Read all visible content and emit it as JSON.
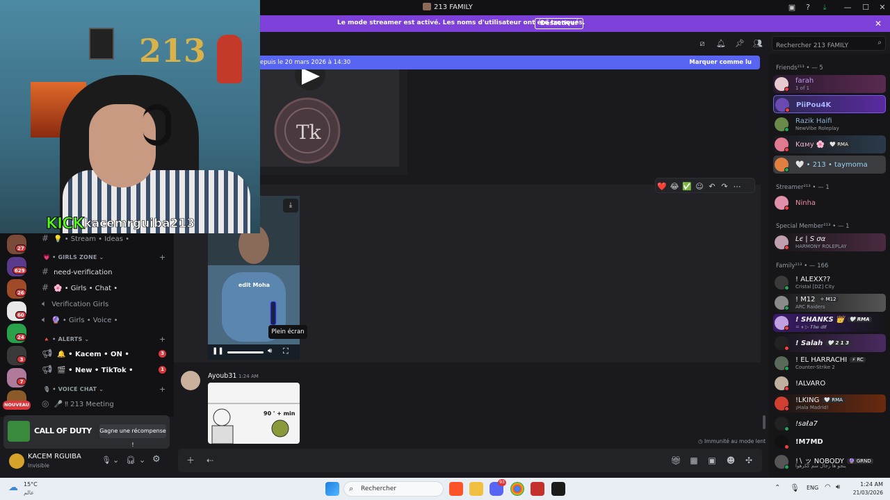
{
  "window": {
    "title": "213 FAMILY"
  },
  "banner": {
    "text": "Le mode streamer est activé. Les noms d'utilisateur ont été tronqués.",
    "button": "Désactiver"
  },
  "search": {
    "placeholder": "Rechercher 213 FAMILY"
  },
  "new_messages": {
    "since": "epuis le 20 mars 2026 à 14:30",
    "mark_read": "Marquer comme lu"
  },
  "stream_overlay": {
    "brand": "KICK",
    "username": "kacemrguiba213",
    "sign_text": "213"
  },
  "server_rail": {
    "badges": [
      "27",
      "629",
      "26",
      "60",
      "24",
      "3",
      "7"
    ],
    "new_label": "NOUVEAU"
  },
  "channels": [
    {
      "type": "channel",
      "label": "💡 • Stream • Ideas •"
    },
    {
      "type": "category",
      "label": "💗 • GIRLS ZONE"
    },
    {
      "type": "channel",
      "label": "need-verification"
    },
    {
      "type": "channel",
      "label": "🌸 • Girls • Chat •"
    },
    {
      "type": "voice",
      "label": "Verification Girls"
    },
    {
      "type": "voice",
      "label": "🔮 • Girls • Voice •"
    },
    {
      "type": "category",
      "label": "🔺 • ALERTS"
    },
    {
      "type": "announce",
      "label": "🔔 • Kacem • ON •",
      "badge": "3"
    },
    {
      "type": "announce",
      "label": "🎬 • New • TikTok •",
      "badge": "1"
    },
    {
      "type": "category",
      "label": "🎙 • VOICE CHAT"
    },
    {
      "type": "stage",
      "label": "🎤 ‼ 213 Meeting"
    }
  ],
  "promo": {
    "game": "CALL OF DUTY",
    "button": "Gagne une récompense !"
  },
  "user": {
    "name": "KACEM RGUIBA",
    "status": "Invisible"
  },
  "video": {
    "caption": "edit Moha",
    "tooltip": "Plein écran"
  },
  "reactions": [
    "❤️",
    "😂",
    "✅"
  ],
  "message": {
    "author": "Ayoub31",
    "time": "1:24 AM",
    "meme_text": "90 ' + min"
  },
  "slowmode": "Immunité au mode lent",
  "members": {
    "groups": [
      {
        "name": "Friends²¹³",
        "count": "— 5"
      },
      {
        "name": "Streamer²¹³",
        "count": "— 1"
      },
      {
        "name": "Special Member²¹³",
        "count": "— 1"
      },
      {
        "name": "Family²¹³",
        "count": "— 166"
      }
    ],
    "list": [
      {
        "name": "farah",
        "sub": "1 of 1",
        "color": "#c19cf0"
      },
      {
        "name": "PiiPou4K",
        "sub": "",
        "color": "#a8b4ff"
      },
      {
        "name": "Razik Haifi",
        "sub": "NewVibe Roleplay",
        "color": "#8fb2d9"
      },
      {
        "name": "Kαмy 🌸",
        "sub": "",
        "tag": "🤍 RMA",
        "color": "#f0b0d0"
      },
      {
        "name": "🤍 • 213 • taymoma",
        "sub": "",
        "color": "#9ad0f0"
      },
      {
        "name": "Ninha",
        "sub": "",
        "color": "#f38ba0"
      },
      {
        "name": "Lє | Ѕ σα",
        "sub": "HARMONY ROLEPLAY",
        "color": "#f2f3f5"
      },
      {
        "name": "! ALEXX??",
        "sub": "Cristal [DZ] City",
        "color": "#f2f3f5"
      },
      {
        "name": "! M12",
        "sub": "ARC Raiders",
        "tag": "✧ M12",
        "color": "#f2f3f5"
      },
      {
        "name": "! SHANKS 👑",
        "sub": "= ⏸ ▷ 𝑻𝒉𝒆 𝒅𝒊𝒇",
        "tag": "🤍 RMA",
        "color": "#f2f3f5"
      },
      {
        "name": "! Salah",
        "sub": "",
        "tag": "🤍 2 1 3",
        "color": "#f2f3f5"
      },
      {
        "name": "! EL HARRACHI",
        "sub": "Counter-Strike 2",
        "tag": "⚡ RC",
        "color": "#f2f3f5"
      },
      {
        "name": "!ALVARO",
        "sub": "",
        "color": "#f2f3f5"
      },
      {
        "name": "!LKING",
        "sub": "¡Hala Madrid!",
        "tag": "🤍 RMA",
        "color": "#f2f3f5"
      },
      {
        "name": "!saℓa7",
        "sub": "",
        "color": "#f2f3f5"
      },
      {
        "name": "!M7MD",
        "sub": "",
        "color": "#f2f3f5"
      },
      {
        "name": "!∖ ッ NOBODY",
        "sub": "ينجو ها رجال منم ككرهوا",
        "tag": "🔮 GRND",
        "color": "#f2f3f5"
      }
    ]
  },
  "taskbar": {
    "temp": "15°C",
    "location": "عالم",
    "search": "Rechercher",
    "discord_badge": "93",
    "lang": "ENG",
    "time": "1:24 AM",
    "date": "21/03/2026"
  },
  "colors": {
    "accent": "#5865f2",
    "banner": "#7d41d9",
    "danger": "#da373c",
    "online": "#23a55a",
    "kick": "#53fc18"
  }
}
